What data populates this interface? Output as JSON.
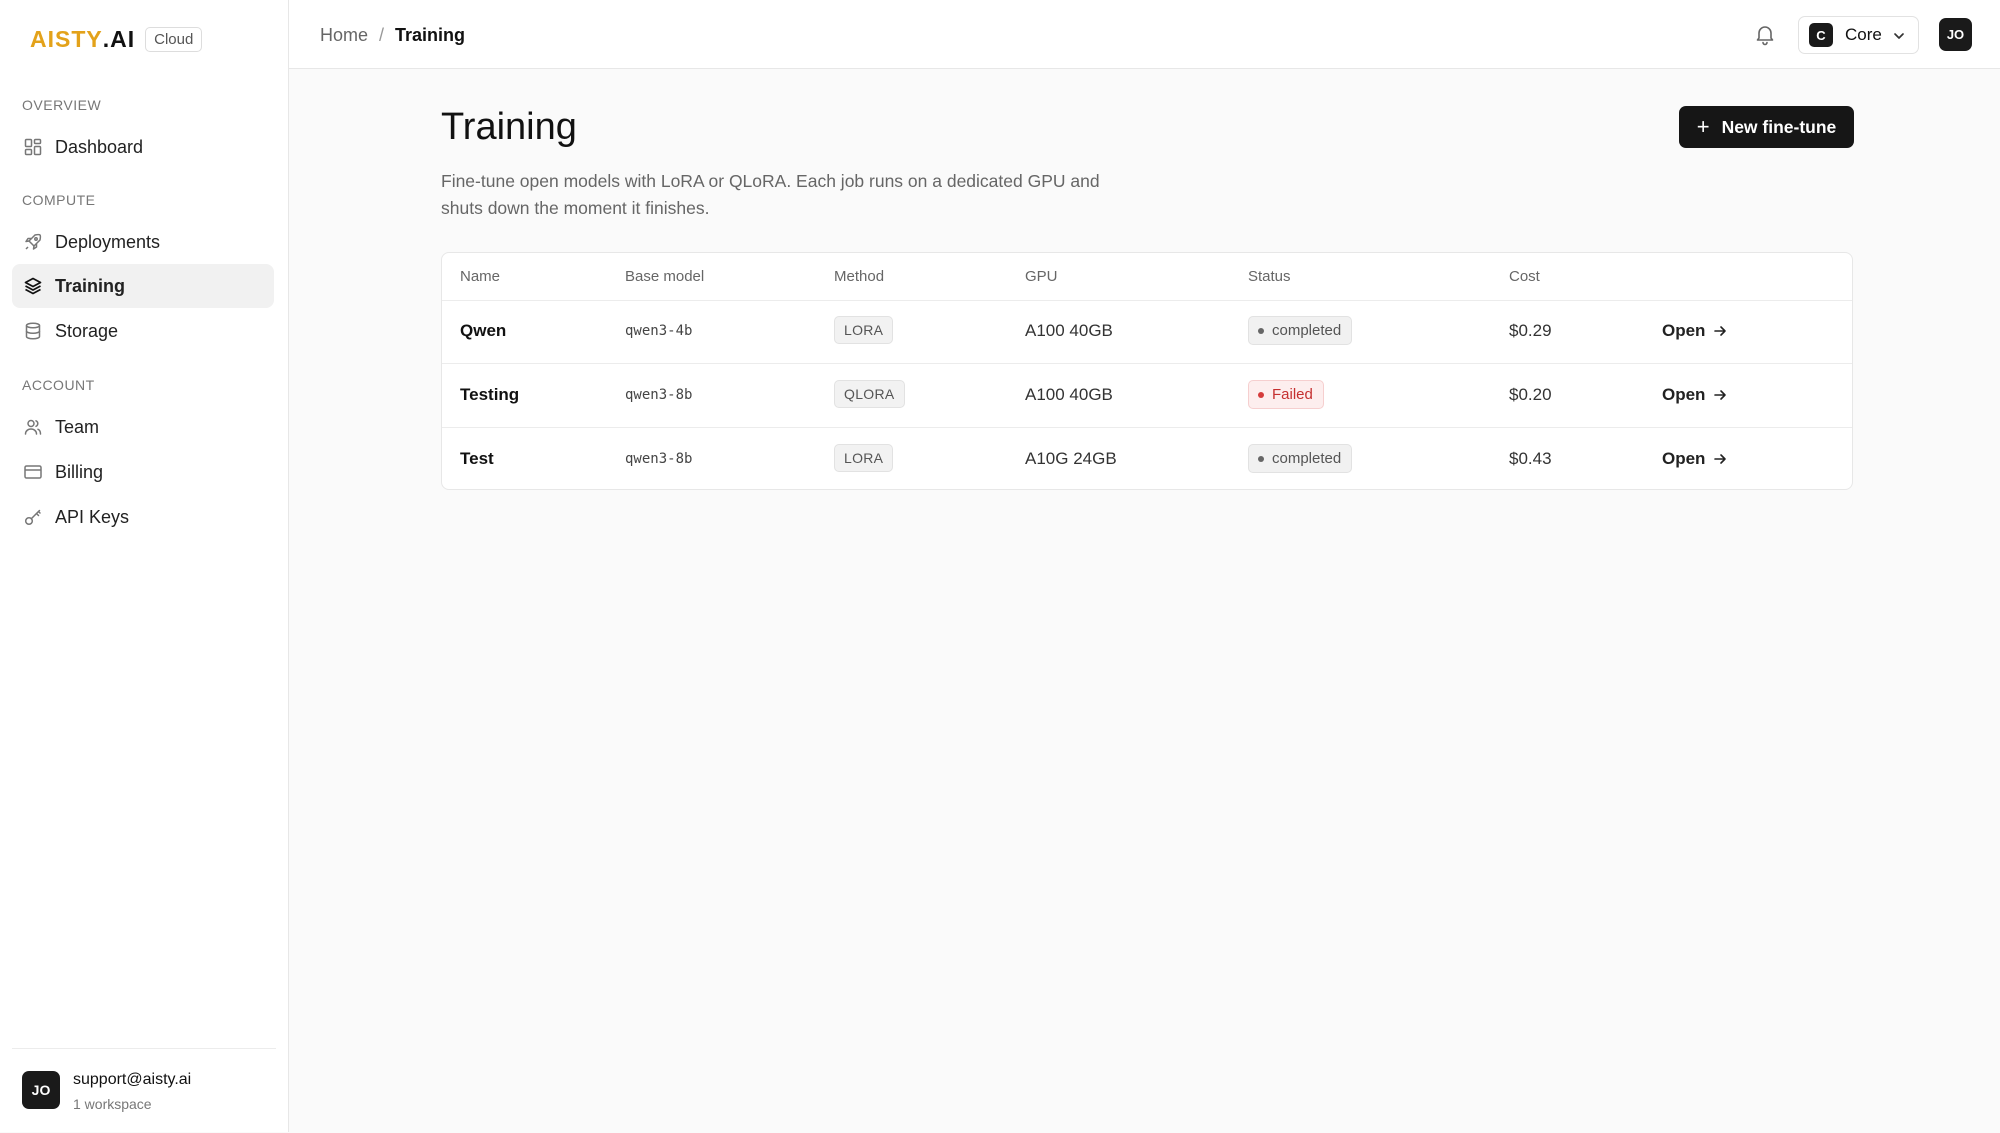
{
  "brand": {
    "logo_gold": "AISTY",
    "logo_dark": ".AI",
    "badge": "Cloud"
  },
  "sidebar": {
    "sections": [
      {
        "label": "OVERVIEW"
      },
      {
        "label": "COMPUTE"
      },
      {
        "label": "ACCOUNT"
      }
    ],
    "items": [
      {
        "label": "Dashboard",
        "icon": "dashboard-icon"
      },
      {
        "label": "Deployments",
        "icon": "rocket-icon"
      },
      {
        "label": "Training",
        "icon": "layers-icon",
        "active": true
      },
      {
        "label": "Storage",
        "icon": "database-icon"
      },
      {
        "label": "Team",
        "icon": "users-icon"
      },
      {
        "label": "Billing",
        "icon": "credit-card-icon"
      },
      {
        "label": "API Keys",
        "icon": "key-icon"
      }
    ],
    "footer": {
      "avatar": "JO",
      "email": "support@aisty.ai",
      "sub": "1 workspace"
    }
  },
  "topbar": {
    "breadcrumb": [
      "Home",
      "Training"
    ],
    "breadcrumb_sep": "/",
    "workspace": {
      "badge": "C",
      "name": "Core"
    },
    "avatar": "JO"
  },
  "main": {
    "title": "Training",
    "description": "Fine-tune open models with LoRA or QLoRA. Each job runs on a dedicated GPU and shuts down the moment it finishes.",
    "new_button": "New fine-tune",
    "new_button_icon": "+",
    "table": {
      "columns": [
        "Name",
        "Base model",
        "Method",
        "GPU",
        "Status",
        "Cost"
      ],
      "rows": [
        {
          "name": "Qwen",
          "base_model": "qwen3-4b",
          "method": "LORA",
          "gpu": "A100 40GB",
          "status": "completed",
          "status_type": "ok",
          "cost": "$0.29",
          "action": "Open"
        },
        {
          "name": "Testing",
          "base_model": "qwen3-8b",
          "method": "QLORA",
          "gpu": "A100 40GB",
          "status": "Failed",
          "status_type": "fail",
          "cost": "$0.20",
          "action": "Open"
        },
        {
          "name": "Test",
          "base_model": "qwen3-8b",
          "method": "LORA",
          "gpu": "A10G 24GB",
          "status": "completed",
          "status_type": "ok",
          "cost": "$0.43",
          "action": "Open"
        }
      ]
    }
  },
  "colors": {
    "accent_gold": "#e3a21a",
    "primary_dark": "#161616",
    "failed_red": "#c53030"
  }
}
